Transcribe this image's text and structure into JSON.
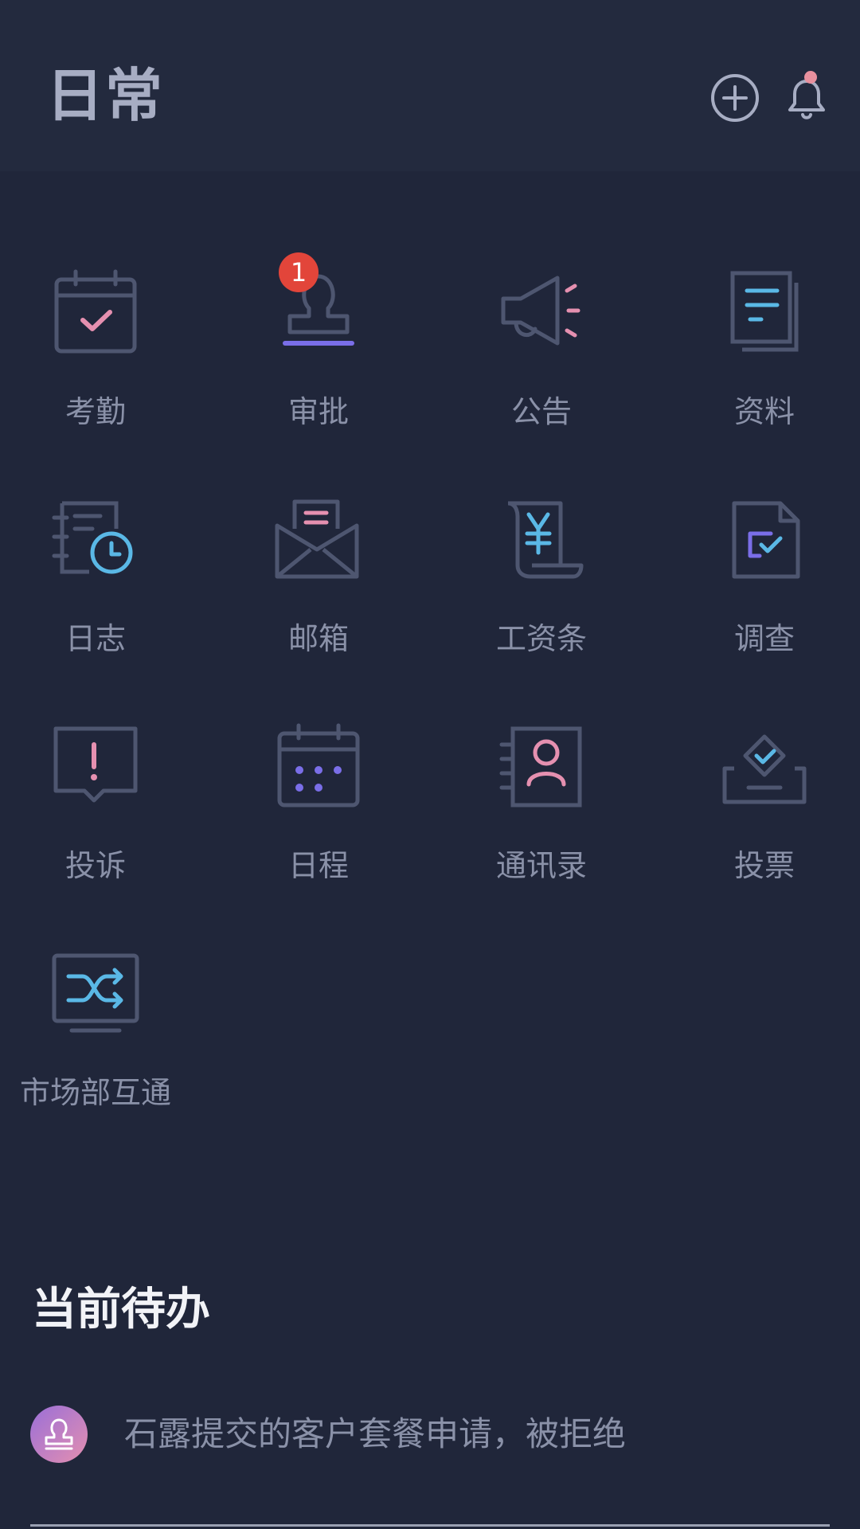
{
  "header": {
    "title": "日常",
    "add_icon": "plus-circle-icon",
    "bell_icon": "bell-icon",
    "bell_dot_color": "#e8909e"
  },
  "grid": {
    "items": [
      {
        "label": "考勤",
        "icon": "attendance-calendar-check-icon"
      },
      {
        "label": "审批",
        "icon": "approval-stamp-icon",
        "badge": "1"
      },
      {
        "label": "公告",
        "icon": "announcement-megaphone-icon"
      },
      {
        "label": "资料",
        "icon": "documents-icon"
      },
      {
        "label": "日志",
        "icon": "log-clock-icon"
      },
      {
        "label": "邮箱",
        "icon": "mailbox-envelope-icon"
      },
      {
        "label": "工资条",
        "icon": "payslip-yuan-icon"
      },
      {
        "label": "调查",
        "icon": "survey-file-check-icon"
      },
      {
        "label": "投诉",
        "icon": "complaint-alert-icon"
      },
      {
        "label": "日程",
        "icon": "schedule-calendar-icon"
      },
      {
        "label": "通讯录",
        "icon": "contacts-person-icon"
      },
      {
        "label": "投票",
        "icon": "vote-ballot-icon"
      },
      {
        "label": "市场部互通",
        "icon": "shuffle-monitor-icon"
      }
    ]
  },
  "todo": {
    "title": "当前待办",
    "items": [
      {
        "text": "石露提交的客户套餐申请，被拒绝",
        "icon": "approval-stamp-icon"
      }
    ]
  },
  "colors": {
    "background": "#20263a",
    "header_bg": "#232a3e",
    "icon_stroke": "#4e5670",
    "accent_pink": "#e590b0",
    "accent_blue": "#5ab8e6",
    "accent_purple": "#7a6ee8",
    "badge_red": "#e2453a"
  }
}
